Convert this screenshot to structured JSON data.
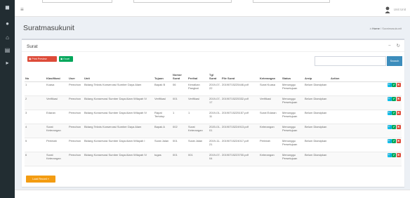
{
  "navbar": {
    "menu_icon": "bars-icon",
    "user_name": "Unit Unit"
  },
  "sidebar": {
    "icons": [
      "logo-icon",
      "user-icon",
      "home-icon",
      "archive-icon",
      "inbox-icon"
    ]
  },
  "header": {
    "title": "Suratmasukunit",
    "breadcrumb": {
      "home": "Home",
      "current": "Suratmasukunit"
    }
  },
  "box": {
    "title": "Surat",
    "collapse_label": "−",
    "refresh_label": "↻",
    "print_label": "Print Preview",
    "excel_label": "Excel",
    "search_value": "",
    "search_label": "Search",
    "load_more_label": "Load Record"
  },
  "table": {
    "headers": [
      "No",
      "Klasifikasi",
      "User",
      "Unit",
      "Tujuan",
      "Nomor Surat",
      "Perihal",
      "Tgl Surat",
      "File Surat",
      "Keterangan",
      "Status",
      "Arsip",
      "Action"
    ],
    "rows": [
      [
        "1",
        "Kuasa",
        "Pemohon",
        "Bidang Teknis Konservasi Sumber Daya Alam",
        "Bapak B",
        "06",
        "Kenaikan Pangkat",
        "2019-07-22",
        "20190715225446.pdf",
        "Surat Kuasa",
        "Menunggu Persetujuan",
        "Belum Diarsipkan"
      ],
      [
        "2",
        "Verifikasi",
        "Pemohon",
        "Bidang Konservasi Sumber Daya Alam Wilayah IV",
        "Verifikasi",
        "001",
        "Verifikasi",
        "2019-07-17",
        "20190715225332.pdf",
        "Verifikasi",
        "Menunggu Persetujuan",
        "Belum Diarsipkan"
      ],
      [
        "3",
        "Edaran",
        "Pemohon",
        "Bidang Konservasi Sumber Daya Alam Wilayah IV",
        "Rapat Tertutup",
        "1",
        "1",
        "2019-01-11",
        "20190715225157.pdf",
        "Surat Edaran",
        "Menunggu Persetujuan",
        "Belum Diarsipkan"
      ],
      [
        "4",
        "Surat Keterangan",
        "Pemohon",
        "Bidang Teknis Konservasi Sumber Daya Alam",
        "Bapak A",
        "002",
        "Surat Keterangan",
        "2020-01-01",
        "20190715224913.pdf",
        "Keterangan",
        "Menunggu Persetujuan",
        "Belum Diarsipkan"
      ],
      [
        "5",
        "Perintah",
        "Pemohon",
        "Bidang Konservasi Sumber Daya Alam Wilayah I",
        "Surat Jalan",
        "001",
        "Surat Jalan",
        "2019-11-21",
        "20190715224017.pdf",
        "Perintah",
        "Menunggu Persetujuan",
        "Belum Diarsipkan"
      ],
      [
        "6",
        "Surat Keterangan",
        "Pemohon",
        "Bidang Konservasi Sumber Daya Alam Wilayah IV",
        "tugas",
        "001",
        "001",
        "2019-07-04",
        "20190715223700.pdf",
        "Keterangan",
        "Menunggu Persetujuan",
        "Belum Diarsipkan"
      ]
    ],
    "action_icons": [
      "search-icon",
      "check-icon",
      "close-icon"
    ]
  },
  "colors": {
    "sidebar": "#222d32",
    "primary": "#3c8dbc",
    "danger": "#dd4b39",
    "success": "#00a65a",
    "warning": "#f39c12",
    "info": "#00c0ef"
  }
}
